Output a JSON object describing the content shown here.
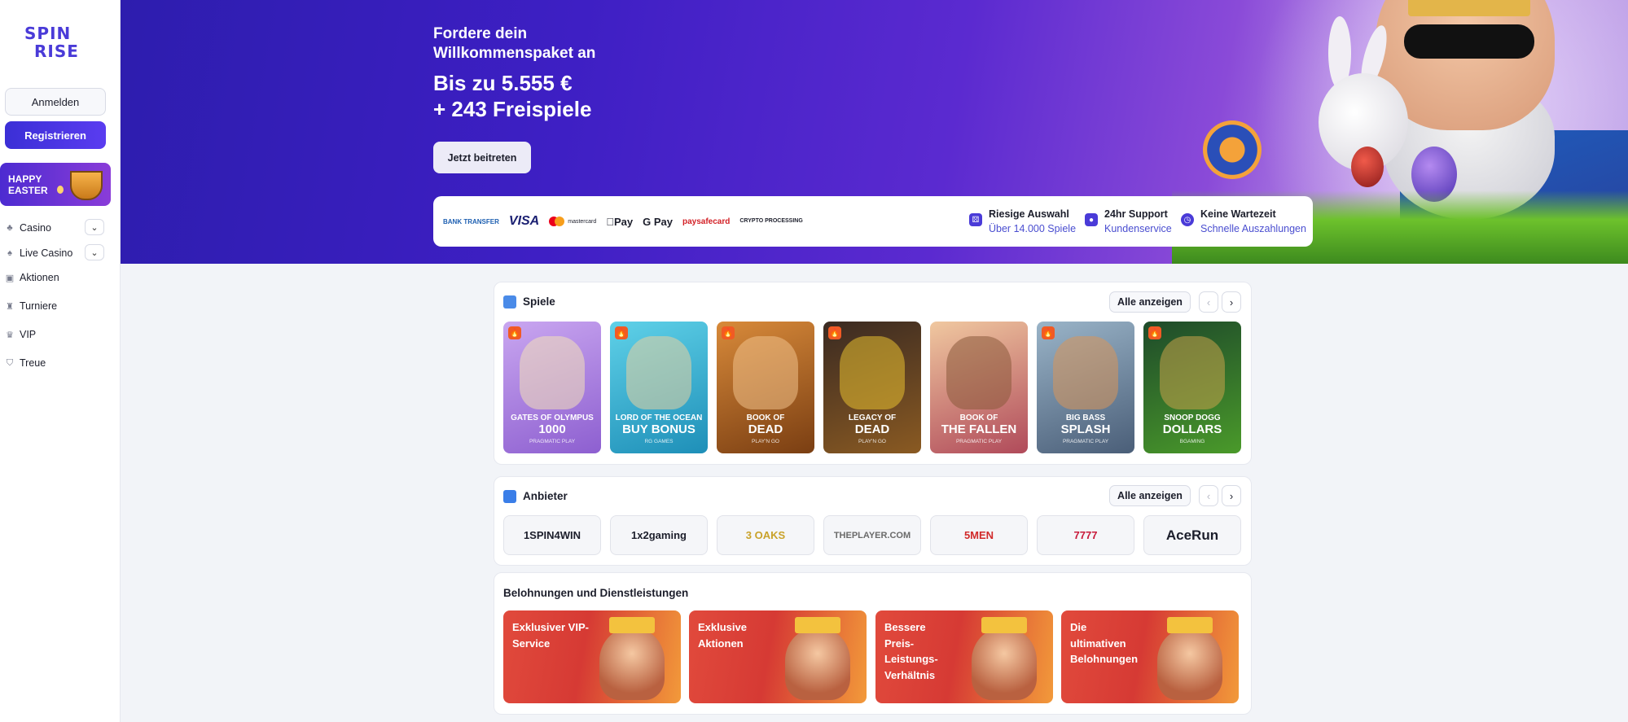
{
  "brand": {
    "line1": "SPIN",
    "line2": "RISE"
  },
  "sidebar": {
    "login": "Anmelden",
    "register": "Registrieren",
    "promo": "HAPPY EASTER",
    "items": [
      {
        "label": "Casino",
        "icon": "cards-icon"
      },
      {
        "label": "Live Casino",
        "icon": "spade-icon"
      },
      {
        "label": "Aktionen",
        "icon": "gift-icon"
      },
      {
        "label": "Turniere",
        "icon": "trophy-icon"
      },
      {
        "label": "VIP",
        "icon": "crown-icon"
      },
      {
        "label": "Treue",
        "icon": "shield-icon"
      }
    ]
  },
  "hero": {
    "sub1": "Fordere dein",
    "sub2": "Willkommenspaket an",
    "main1": "Bis zu 5.555 €",
    "main2": "+ 243 Freispiele",
    "cta": "Jetzt beitreten"
  },
  "payments": {
    "bank": "BANK TRANSFER",
    "visa": "VISA",
    "mastercard": "mastercard",
    "applepay": "Pay",
    "googlepay": "G Pay",
    "paysafe": "paysafecard",
    "crypto": "CRYPTO PROCESSING"
  },
  "features": [
    {
      "title": "Riesige Auswahl",
      "sub": "Über 14.000 Spiele"
    },
    {
      "title": "24hr Support",
      "sub": "Kundenservice"
    },
    {
      "title": "Keine Wartezeit",
      "sub": "Schnelle Auszahlungen"
    }
  ],
  "games_section": {
    "title": "Spiele",
    "see_all": "Alle anzeigen",
    "games": [
      {
        "t1": "GATES OF OLYMPUS",
        "t2": "1000",
        "provider": "PRAGMATIC PLAY",
        "bg": "#9b6fd0"
      },
      {
        "t1": "LORD OF THE OCEAN",
        "t2": "BUY BONUS",
        "provider": "RG GAMES",
        "bg": "#2b9fc4"
      },
      {
        "t1": "BOOK OF",
        "t2": "DEAD",
        "provider": "PLAY'N GO",
        "bg": "#a0561c"
      },
      {
        "t1": "LEGACY OF",
        "t2": "DEAD",
        "provider": "PLAY'N GO",
        "bg": "#7a4a22"
      },
      {
        "t1": "BOOK OF",
        "t2": "THE FALLEN",
        "provider": "PRAGMATIC PLAY",
        "bg": "#b8555e"
      },
      {
        "t1": "BIG BASS",
        "t2": "SPLASH",
        "provider": "PRAGMATIC PLAY",
        "bg": "#6c7f93"
      },
      {
        "t1": "SNOOP DOGG",
        "t2": "DOLLARS",
        "provider": "BGAMING",
        "bg": "#3a7f2a"
      }
    ]
  },
  "providers_section": {
    "title": "Anbieter",
    "see_all": "Alle anzeigen",
    "providers": [
      "1SPIN4WIN",
      "1x2gaming",
      "3 OAKS",
      "THEPLAYER.COM",
      "5MEN",
      "7777",
      "AceRun"
    ]
  },
  "rewards_section": {
    "title": "Belohnungen und Dienstleistungen",
    "items": [
      "Exklusiver VIP-Service",
      "Exklusive Aktionen",
      "Bessere Preis-Leistungs-Verhältnis",
      "Die ultimativen Belohnungen"
    ]
  },
  "colors": {
    "accent": "#4a3bd8",
    "hot": "#f15a24",
    "link": "#4a4ed0"
  }
}
